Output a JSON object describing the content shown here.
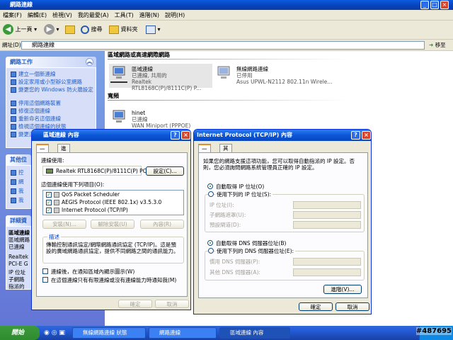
{
  "explorer": {
    "title": "網路連線",
    "menu": [
      "檔案(F)",
      "編輯(E)",
      "檢視(V)",
      "我的最愛(A)",
      "工具(T)",
      "進階(N)",
      "說明(H)"
    ],
    "toolbar": {
      "back": "上一頁",
      "search": "搜尋",
      "folders": "資料夾"
    },
    "address_label": "網址(D)",
    "address_value": "網路連線",
    "go_label": "移至"
  },
  "taskpane": {
    "network_tasks_title": "網路工作",
    "network_tasks": [
      "建立一個新連線",
      "設定家用或小型辦公室網路",
      "變更您的 Windows 防火牆設定",
      "停用這個網路裝置",
      "修復這個連線",
      "重新命名這個連線",
      "檢視這個連線的狀態",
      "變更這個連線的設定"
    ],
    "other_title": "其他位",
    "other_items": [
      "控",
      "網",
      "我",
      "我"
    ],
    "details_title": "詳細資",
    "details_lines": [
      "區域連線",
      "區域網路",
      "已連線",
      "Realtek",
      "PCI-E G",
      "IP 位址",
      "子網路",
      "指派的"
    ]
  },
  "content": {
    "section_lan": "區域網路或高速網際網路",
    "section_dialup": "寬頻",
    "connections": [
      {
        "name": "區域連線",
        "status": "已連線, 共用的",
        "device": "Realtek RTL8168C(P)/8111C(P) P..."
      },
      {
        "name": "無線網路連線",
        "status": "已停用",
        "device": "Asus UPWL-N2112 802.11n Wirele..."
      },
      {
        "name": "hinet",
        "status": "已連線",
        "device": "WAN Miniport (PPPOE)"
      }
    ]
  },
  "lan_props": {
    "title": "區域連線 內容",
    "tabs": [
      "一般",
      "進階"
    ],
    "connect_using_label": "連線使用:",
    "adapter_name": "Realtek RTL8168C(P)/8111C(P) PCI",
    "configure_label": "設定(C)...",
    "items_label": "這個連線使用下列項目(O):",
    "items": [
      "QoS Packet Scheduler",
      "AEGIS Protocol (IEEE 802.1x) v3.5.3.0",
      "Internet Protocol (TCP/IP)"
    ],
    "install_label": "安裝(N)...",
    "uninstall_label": "解除安裝(U)",
    "properties_label": "內容(R)",
    "description_title": "描述",
    "description_text": "傳輸控制通訊協定/網際網路通訊協定 (TCP/IP)。這是預設的廣域網路通訊協定，提供不同網路之間的通訊能力。",
    "show_icon_label": "連線後，在通知區域內顯示圖示(W)",
    "notify_label": "在這個連線只有有限連線或沒有連線能力時通知我(M)",
    "ok_label": "確定",
    "cancel_label": "取消"
  },
  "tcpip": {
    "title": "Internet Protocol (TCP/IP) 內容",
    "tabs": [
      "一般",
      "其他設定"
    ],
    "intro": "如果您的網路支援這項功能，您可以取得自動指派的 IP 設定。否則，您必須詢問網路系統管理員正確的 IP 設定。",
    "auto_ip": "自動取得 IP 位址(O)",
    "manual_ip": "使用下列的 IP 位址(S):",
    "ip_label": "IP 位址(I):",
    "mask_label": "子網路遮罩(U):",
    "gateway_label": "預設閘道(D):",
    "auto_dns": "自動取得 DNS 伺服器位址(B)",
    "manual_dns": "使用下列的 DNS 伺服器位址(E):",
    "preferred_dns": "慣用 DNS 伺服器(P):",
    "alternate_dns": "其他 DNS 伺服器(A):",
    "advanced_label": "進階(V)...",
    "ok_label": "確定",
    "cancel_label": "取消"
  },
  "taskbar": {
    "start_label": "開始",
    "tasks": [
      "無線網路連線 狀態",
      "網路連線",
      "區域連線 內容"
    ]
  },
  "watermark": "#487695"
}
